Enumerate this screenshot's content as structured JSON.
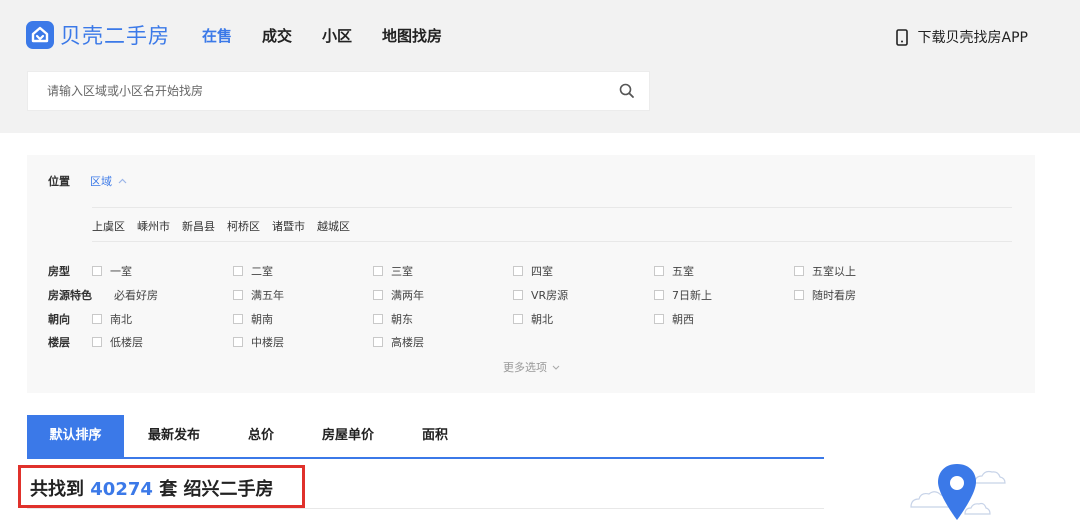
{
  "header": {
    "logo_text": "贝壳二手房",
    "nav": [
      "在售",
      "成交",
      "小区",
      "地图找房"
    ],
    "app_link": "下载贝壳找房APP"
  },
  "search": {
    "placeholder": "请输入区域或小区名开始找房"
  },
  "filter": {
    "location_label": "位置",
    "location_tab": "区域",
    "districts": [
      "上虞区",
      "嵊州市",
      "新昌县",
      "柯桥区",
      "诸暨市",
      "越城区"
    ],
    "rows": [
      {
        "label": "房型",
        "options": [
          "一室",
          "二室",
          "三室",
          "四室",
          "五室",
          "五室以上"
        ]
      },
      {
        "label": "房源特色",
        "options": [
          "必看好房",
          "满五年",
          "满两年",
          "VR房源",
          "7日新上",
          "随时看房"
        ]
      },
      {
        "label": "朝向",
        "options": [
          "南北",
          "朝南",
          "朝东",
          "朝北",
          "朝西"
        ]
      },
      {
        "label": "楼层",
        "options": [
          "低楼层",
          "中楼层",
          "高楼层"
        ]
      }
    ],
    "more_label": "更多选项"
  },
  "sort": {
    "tabs": [
      "默认排序",
      "最新发布",
      "总价",
      "房屋单价",
      "面积"
    ],
    "active": "默认排序"
  },
  "result": {
    "prefix": "共找到",
    "count": "40274",
    "suffix": "套 绍兴二手房"
  },
  "colors": {
    "brand": "#3b79e8",
    "highlight_border": "#e0312b"
  }
}
